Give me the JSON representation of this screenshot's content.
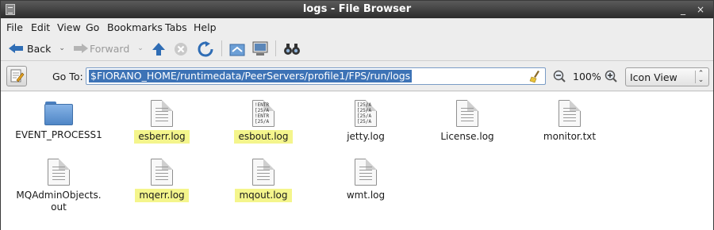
{
  "window": {
    "title": "logs - File Browser",
    "minimize": "_",
    "close": "×"
  },
  "menu": [
    "File",
    "Edit",
    "View",
    "Go",
    "Bookmarks",
    "Tabs",
    "Help"
  ],
  "toolbar": {
    "back_label": "Back",
    "forward_label": "Forward",
    "icons": [
      "back-arrow-icon",
      "forward-arrow-icon",
      "up-arrow-icon",
      "stop-icon",
      "reload-icon",
      "home-icon",
      "computer-icon",
      "search-binoculars-icon"
    ]
  },
  "location": {
    "goto_label": "Go To:",
    "path": "$FIORANO_HOME/runtimedata/PeerServers/profile1/FPS/run/logs",
    "zoom": "100%",
    "view_mode": "Icon View"
  },
  "files": [
    {
      "name": "EVENT_PROCESS1",
      "type": "folder",
      "highlighted": false
    },
    {
      "name": "esberr.log",
      "type": "document",
      "highlighted": true
    },
    {
      "name": "esbout.log",
      "type": "log-preview",
      "preview": "!ENTR\n[25/A\n!ENTR\n[25/A",
      "highlighted": true
    },
    {
      "name": "jetty.log",
      "type": "log-preview",
      "preview": "[25/A\n[25/A\n[25/A\n[25/A",
      "highlighted": false
    },
    {
      "name": "License.log",
      "type": "document",
      "highlighted": false
    },
    {
      "name": "monitor.txt",
      "type": "document",
      "highlighted": false
    },
    {
      "name": "MQAdminObjects.\nout",
      "type": "document",
      "highlighted": false
    },
    {
      "name": "mqerr.log",
      "type": "document",
      "highlighted": true
    },
    {
      "name": "mqout.log",
      "type": "document",
      "highlighted": true
    },
    {
      "name": "wmt.log",
      "type": "document",
      "highlighted": false
    }
  ],
  "colors": {
    "highlight": "#f4f58c",
    "selection": "#3d73b6",
    "folder": "#5b8fd0"
  }
}
